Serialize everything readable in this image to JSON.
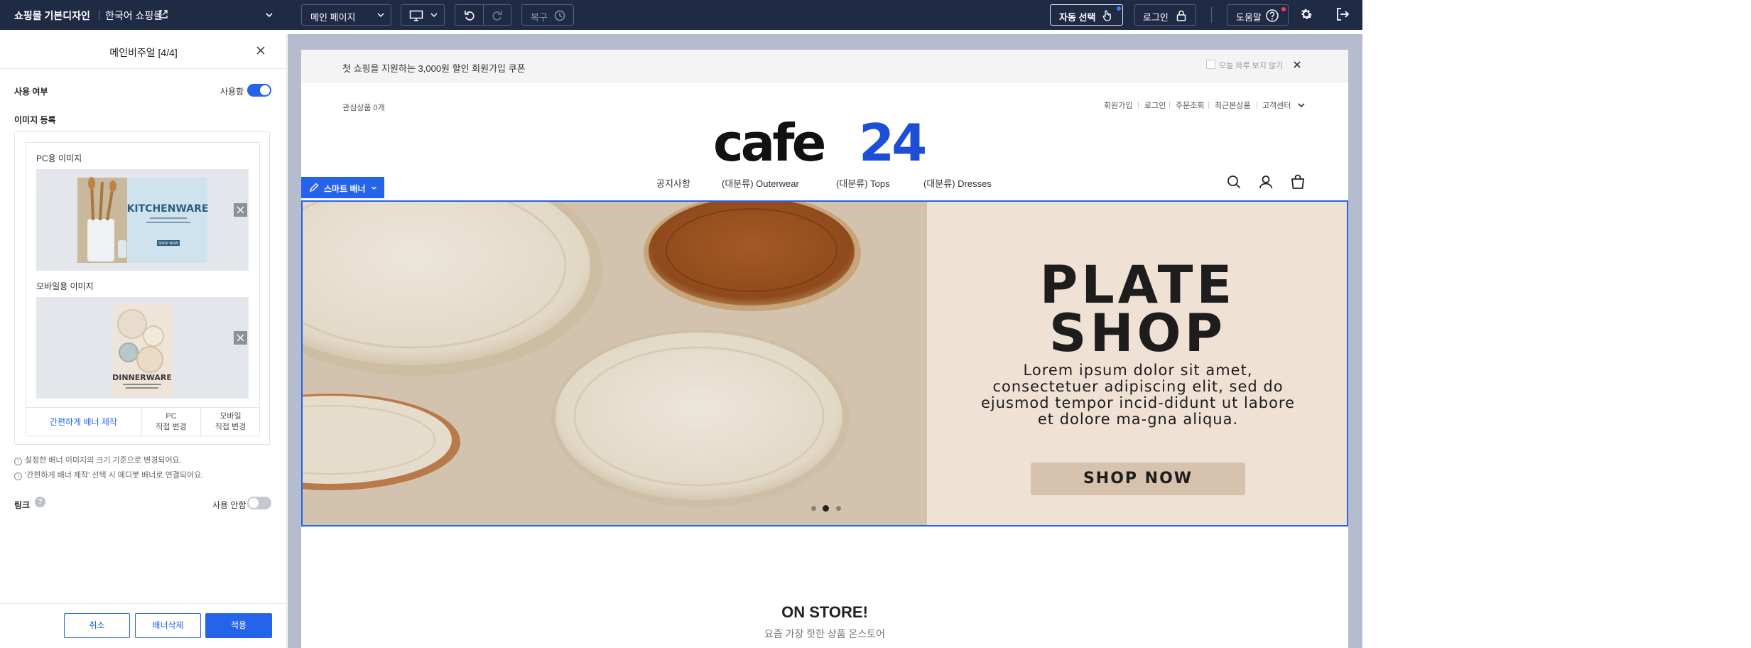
{
  "topbar": {
    "title": "쇼핑몰 기본디자인",
    "shop": "한국어 쇼핑몰",
    "page_select": "메인 페이지",
    "restore": "복구",
    "auto_select": "자동 선택",
    "login": "로그인",
    "help": "도움말"
  },
  "panel": {
    "title": "메인비주얼 [4/4]",
    "use_label": "사용 여부",
    "use_value": "사용함",
    "image_reg": "이미지 등록",
    "pc_image_label": "PC용 이미지",
    "mobile_image_label": "모바일용 이미지",
    "pc_thumb_text": "KITCHENWARE",
    "pc_thumb_btn": "SHOP NOW",
    "mobile_thumb_text": "DINNERWARE",
    "easy_banner": "간편하게 배너 제작",
    "pc_change_1": "PC",
    "pc_change_2": "직접 변경",
    "mobile_change_1": "모바일",
    "mobile_change_2": "직접 변경",
    "note1": "설정한 배너 이미지의 크기 기준으로 변경되어요.",
    "note2": "'간편하게 배너 제작' 선택 시 에디봇 배너로 연결되어요.",
    "link_label": "링크",
    "link_value": "사용 안함",
    "cancel": "취소",
    "delete_banner": "배너삭제",
    "apply": "적용"
  },
  "site": {
    "coupon": "첫 쇼핑을 지원하는 3,000원 할인 회원가입 쿠폰",
    "hide_today": "오늘 하루 보지 않기",
    "interest": "관심상품 0개",
    "util": [
      "회원가입",
      "로그인",
      "주문조회",
      "최근본상품",
      "고객센터"
    ],
    "logo_a": "cafe",
    "logo_b": "24",
    "nav": [
      "공지사항",
      "(대분류) Outerwear",
      "(대분류) Tops",
      "(대분류) Dresses"
    ],
    "smart_banner": "스마트 배너",
    "banner_title_1": "PLATE",
    "banner_title_2": "SHOP",
    "banner_body": "Lorem ipsum dolor sit amet, consectetuer adipiscing elit, sed do ejusmod tempor incid-didunt ut labore et dolore ma-gna aliqua.",
    "banner_btn": "SHOP NOW",
    "slide_active": 2,
    "slide_count": 3,
    "onstore_title": "ON STORE!",
    "onstore_sub": "요즘 가장 핫한 상품 온스토어"
  },
  "colors": {
    "topbar_bg": "#1f2a44",
    "accent": "#2563eb",
    "canvas_bg": "#b4bccd",
    "banner_panel": "#efe1d4"
  }
}
